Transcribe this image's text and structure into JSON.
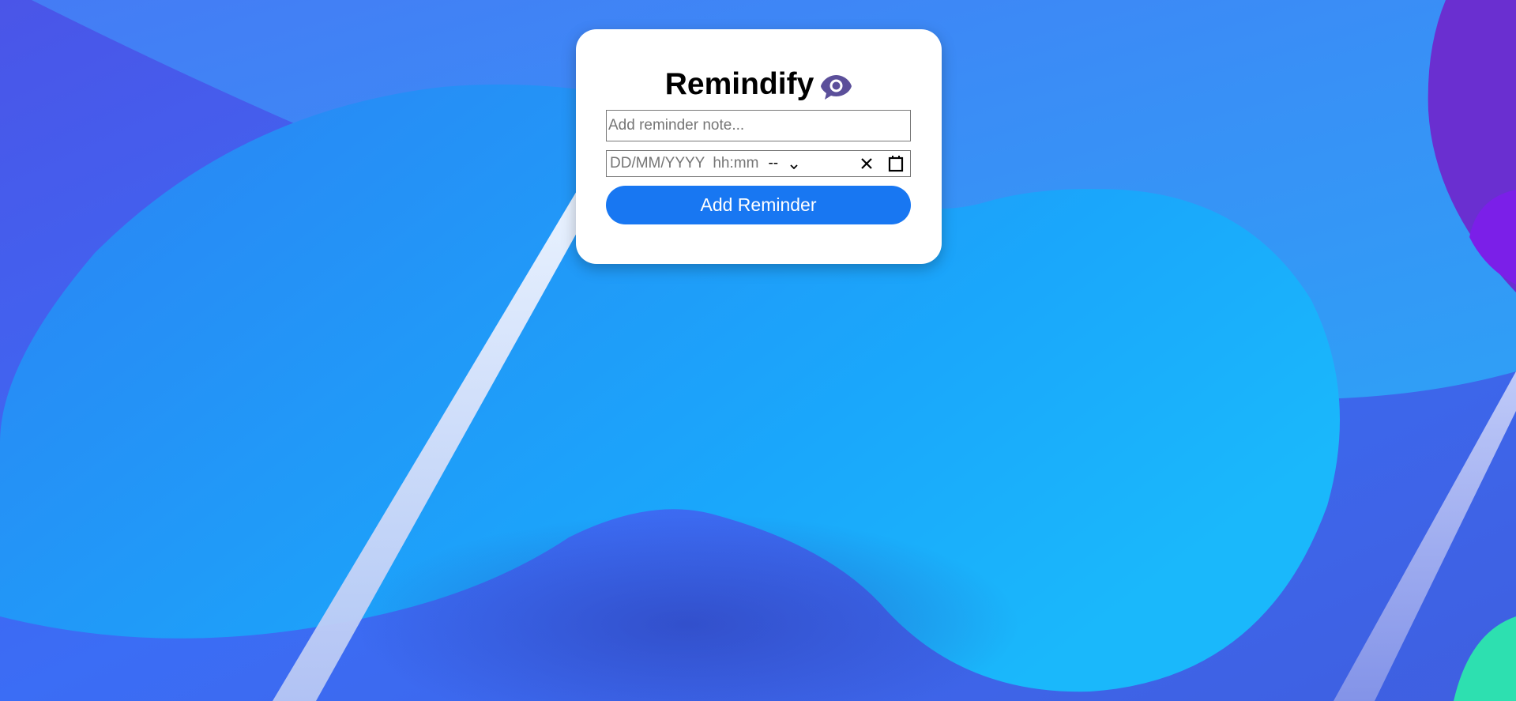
{
  "app": {
    "title": "Remindify",
    "title_icon": "eye-chat-icon"
  },
  "form": {
    "note_placeholder": "Add reminder note...",
    "note_value": "",
    "datetime": {
      "date_placeholder": "DD/MM/YYYY",
      "time_placeholder": "hh:mm",
      "ampm_value": "--"
    },
    "submit_label": "Add Reminder"
  },
  "colors": {
    "accent": "#1877f2",
    "icon": "#5b4f9a",
    "card": "#ffffff"
  }
}
